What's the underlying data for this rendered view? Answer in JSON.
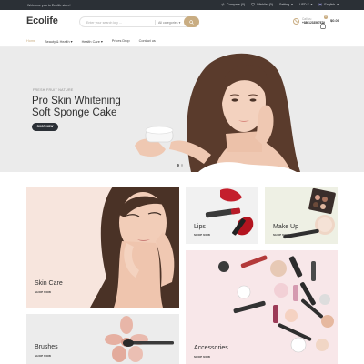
{
  "topbar": {
    "welcome": "Welcome you to Ecolife store!",
    "compare": "Compare (0)",
    "wishlist": "Wishlist (0)",
    "setting": "Setting",
    "currency": "USD $",
    "language": "English"
  },
  "header": {
    "logo": "Ecolife",
    "search_placeholder": "Enter your search key ...",
    "category": "All categories",
    "call_label": "Call us:",
    "call_number": "+8801233567879",
    "cart_count": "0",
    "cart_total": "$0.00"
  },
  "nav": {
    "items": [
      "Home",
      "Beauty & Health",
      "Health Care",
      "Prices Drop",
      "Contact us"
    ]
  },
  "hero": {
    "subtitle": "FRESH FRUIT NATURE",
    "title_line1": "Pro Skin Whitening",
    "title_line2": "Soft Sponge Cake",
    "button": "SHOP NOW"
  },
  "banners": {
    "skin_care": {
      "name": "Skin Care",
      "link": "SHOP NOW"
    },
    "lips": {
      "name": "Lips",
      "link": "SHOP NOW"
    },
    "make_up": {
      "name": "Make Up",
      "link": "SHOP NOW"
    },
    "accessories": {
      "name": "Accessories",
      "link": "SHOP NOW"
    },
    "brushes": {
      "name": "Brushes",
      "link": "SHOP NOW"
    }
  },
  "colors": {
    "accent": "#c9ad82",
    "topbar_bg": "#2b3036",
    "hero_bg": "#ebebeb"
  }
}
